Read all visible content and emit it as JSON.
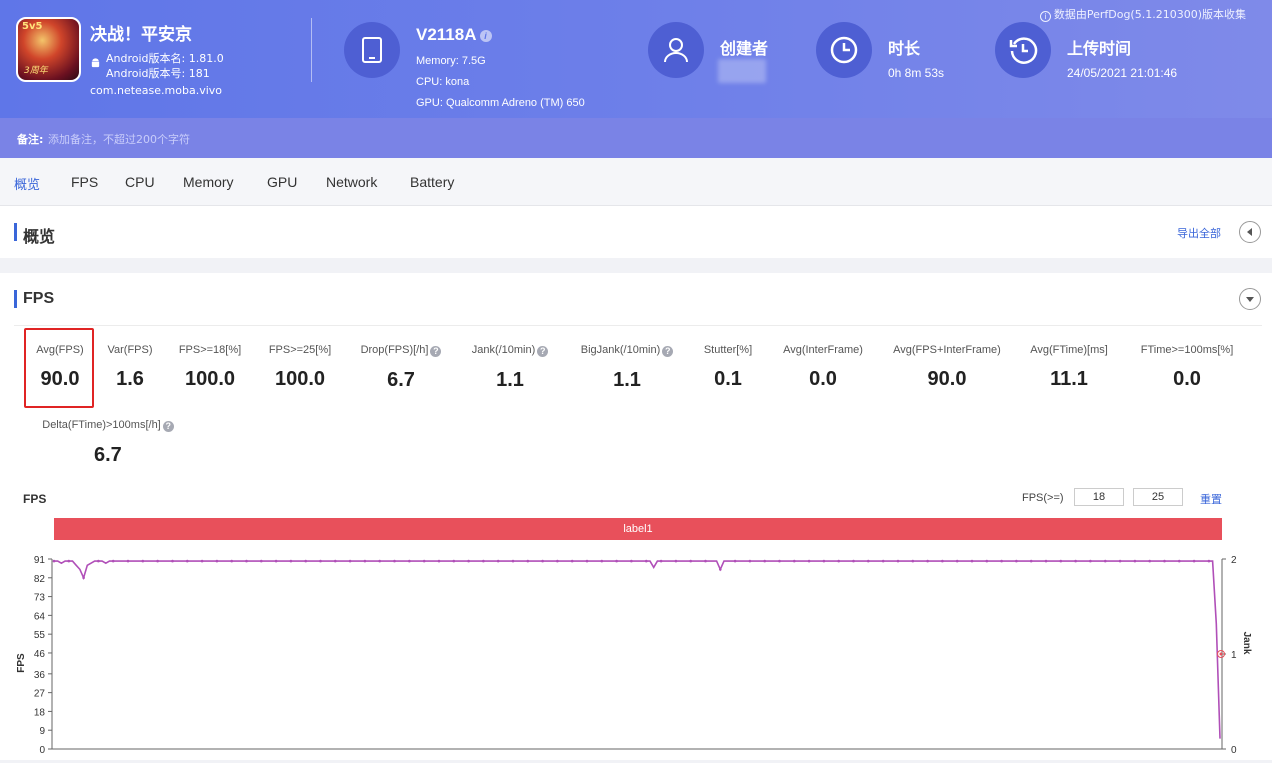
{
  "header": {
    "app": {
      "name": "决战！平安京",
      "version_name": "Android版本名: 1.81.0",
      "version_code": "Android版本号: 181",
      "package": "com.netease.moba.vivo",
      "icon_text": "5v5",
      "icon_subtext": "3周年"
    },
    "device": {
      "model": "V2118A",
      "memory": "Memory: 7.5G",
      "cpu": "CPU: kona",
      "gpu": "GPU: Qualcomm Adreno (TM) 650"
    },
    "creator_label": "创建者",
    "duration_label": "时长",
    "duration_value": "0h 8m 53s",
    "upload_label": "上传时间",
    "upload_value": "24/05/2021 21:01:46",
    "source_note": "数据由PerfDog(5.1.210300)版本收集"
  },
  "remark": {
    "label": "备注:",
    "placeholder": "添加备注，不超过200个字符"
  },
  "tabs": [
    "概览",
    "FPS",
    "CPU",
    "Memory",
    "GPU",
    "Network",
    "Battery"
  ],
  "overview": {
    "title": "概览",
    "export_label": "导出全部"
  },
  "fps_section": {
    "title": "FPS",
    "metrics": [
      {
        "label": "Avg(FPS)",
        "value": "90.0"
      },
      {
        "label": "Var(FPS)",
        "value": "1.6"
      },
      {
        "label": "FPS>=18[%]",
        "value": "100.0"
      },
      {
        "label": "FPS>=25[%]",
        "value": "100.0"
      },
      {
        "label": "Drop(FPS)[/h]",
        "value": "6.7"
      },
      {
        "label": "Jank(/10min)",
        "value": "1.1"
      },
      {
        "label": "BigJank(/10min)",
        "value": "1.1"
      },
      {
        "label": "Stutter[%]",
        "value": "0.1"
      },
      {
        "label": "Avg(InterFrame)",
        "value": "0.0"
      },
      {
        "label": "Avg(FPS+InterFrame)",
        "value": "90.0"
      },
      {
        "label": "Avg(FTime)[ms]",
        "value": "11.1"
      },
      {
        "label": "FTime>=100ms[%]",
        "value": "0.0"
      },
      {
        "label": "Delta(FTime)>100ms[/h]",
        "value": "6.7"
      }
    ],
    "help_glyph": "?",
    "chart_title": "FPS",
    "fps_ge_label": "FPS(>=)",
    "fps_threshold_1": "18",
    "fps_threshold_2": "25",
    "reset_label": "重置",
    "label_bar": "label1"
  },
  "chart_data": {
    "type": "line",
    "ylabel": "FPS",
    "y2label": "Jank",
    "yticks": [
      0,
      9,
      18,
      27,
      36,
      46,
      55,
      64,
      73,
      82,
      91
    ],
    "y2ticks": [
      0,
      1,
      2
    ],
    "ylim": [
      0,
      91
    ],
    "y2lim": [
      0,
      2
    ],
    "series": [
      {
        "name": "FPS",
        "color": "#b04fb8",
        "values": [
          90,
          90,
          89,
          90,
          90,
          90,
          88,
          86,
          82,
          88,
          89,
          90,
          90,
          90,
          89,
          90,
          90,
          90,
          90,
          90,
          90,
          90,
          90,
          90,
          90,
          90,
          90,
          90,
          90,
          90,
          90,
          90,
          90,
          90,
          90,
          90,
          90,
          90,
          90,
          90,
          90,
          90,
          90,
          90,
          90,
          90,
          90,
          90,
          90,
          90,
          90,
          90,
          90,
          90,
          90,
          90,
          90,
          90,
          90,
          90,
          90,
          90,
          90,
          90,
          90,
          90,
          90,
          90,
          90,
          90,
          90,
          90,
          90,
          90,
          90,
          90,
          90,
          90,
          90,
          90,
          90,
          90,
          90,
          90,
          90,
          90,
          90,
          90,
          90,
          90,
          90,
          90,
          90,
          90,
          90,
          90,
          90,
          90,
          90,
          90,
          90,
          90,
          90,
          90,
          90,
          90,
          90,
          90,
          90,
          90,
          90,
          90,
          90,
          90,
          90,
          90,
          90,
          90,
          90,
          90,
          90,
          90,
          90,
          90,
          90,
          90,
          90,
          90,
          90,
          90,
          90,
          90,
          90,
          90,
          90,
          90,
          90,
          90,
          90,
          90,
          90,
          90,
          90,
          90,
          90,
          90,
          90,
          90,
          90,
          90,
          90,
          90,
          90,
          90,
          90,
          90,
          90,
          90,
          90,
          90,
          90,
          90,
          87,
          90,
          90,
          90,
          90,
          90,
          90,
          90,
          90,
          90,
          90,
          90,
          90,
          90,
          90,
          90,
          90,
          90,
          86,
          90,
          90,
          90,
          90,
          90,
          90,
          90,
          90,
          90,
          90,
          90,
          90,
          90,
          90,
          90,
          90,
          90,
          90,
          90,
          90,
          90,
          90,
          90,
          90,
          90,
          90,
          90,
          90,
          90,
          90,
          90,
          90,
          90,
          90,
          90,
          90,
          90,
          90,
          90,
          90,
          90,
          90,
          90,
          90,
          90,
          90,
          90,
          90,
          90,
          90,
          90,
          90,
          90,
          90,
          90,
          90,
          90,
          90,
          90,
          90,
          90,
          90,
          90,
          90,
          90,
          90,
          90,
          90,
          90,
          90,
          90,
          90,
          90,
          90,
          90,
          90,
          90,
          90,
          90,
          90,
          90,
          90,
          90,
          90,
          90,
          90,
          90,
          90,
          90,
          90,
          90,
          90,
          90,
          90,
          90,
          90,
          90,
          90,
          90,
          90,
          90,
          90,
          90,
          90,
          90,
          90,
          90,
          90,
          90,
          90,
          90,
          90,
          90,
          90,
          90,
          90,
          90,
          90,
          90,
          90,
          90,
          90,
          90,
          90,
          90,
          90,
          90,
          90,
          90,
          90,
          90,
          90,
          90,
          60,
          5
        ]
      },
      {
        "name": "Jank",
        "color": "#e8505b",
        "values": [
          1
        ]
      }
    ]
  },
  "colors": {
    "accent": "#3a66d9",
    "header_start": "#5f76e8",
    "highlight": "#e02424",
    "label_bar": "#e8505b"
  }
}
